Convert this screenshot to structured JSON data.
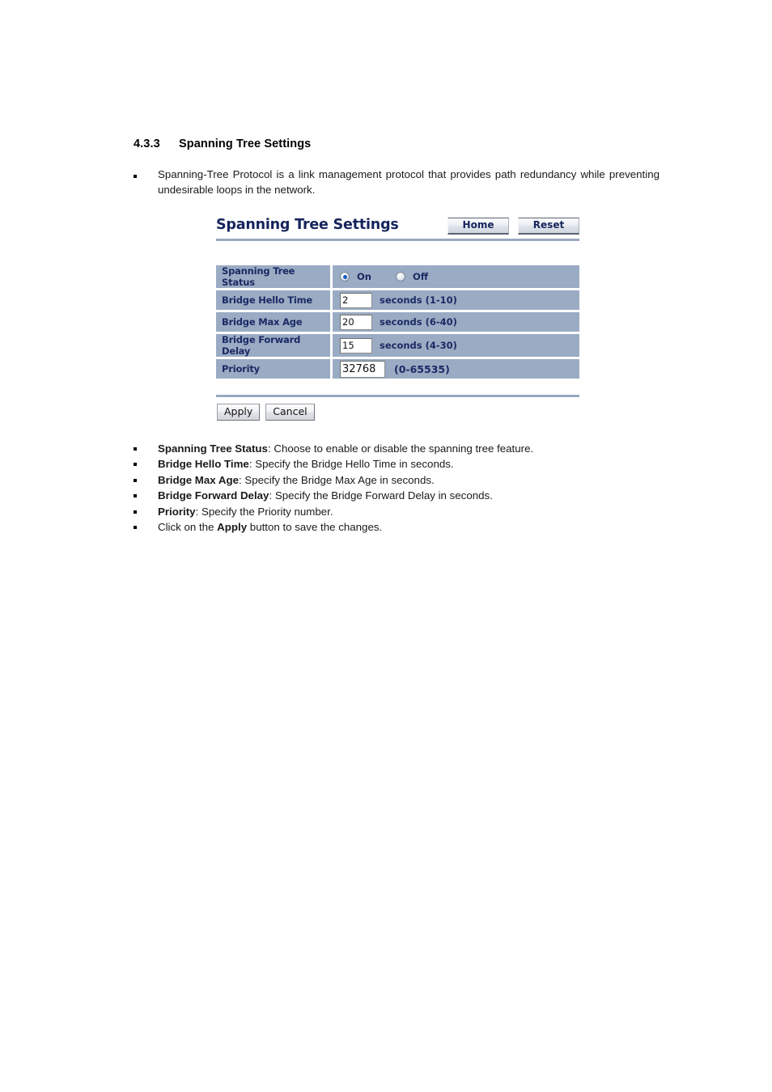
{
  "document": {
    "heading_number": "4.3.3",
    "heading_title": "Spanning Tree Settings",
    "intro_bullet": "Spanning-Tree Protocol is a link management protocol that provides path redundancy while preventing undesirable loops in the network."
  },
  "ui": {
    "title": "Spanning Tree Settings",
    "header_buttons": {
      "home": "Home",
      "reset": "Reset"
    },
    "rows": [
      {
        "label": "Spanning Tree Status",
        "type": "radio",
        "options": [
          {
            "label": "On",
            "checked": true
          },
          {
            "label": "Off",
            "checked": false
          }
        ]
      },
      {
        "label": "Bridge Hello Time",
        "type": "text",
        "value": "2",
        "unit": "seconds (1-10)"
      },
      {
        "label": "Bridge Max Age",
        "type": "text",
        "value": "20",
        "unit": "seconds (6-40)"
      },
      {
        "label": "Bridge Forward Delay",
        "type": "text",
        "value": "15",
        "unit": "seconds (4-30)"
      },
      {
        "label": "Priority",
        "type": "text",
        "value": "32768",
        "unit": "(0-65535)"
      }
    ],
    "footer_buttons": {
      "apply": "Apply",
      "cancel": "Cancel"
    },
    "colors": {
      "row_background": "#9aabc4",
      "label_text": "#1b2a63",
      "title_text": "#16245c",
      "rule": "#9aa8c0",
      "radio_dot": "#1358c8"
    }
  },
  "descriptions": [
    {
      "term": "Spanning Tree Status",
      "rest": ": Choose to enable or disable the spanning tree feature."
    },
    {
      "term": "Bridge Hello Time",
      "rest": ": Specify the Bridge Hello Time in seconds."
    },
    {
      "term": "Bridge Max Age",
      "rest": ": Specify the Bridge Max Age in seconds."
    },
    {
      "term": "Bridge Forward Delay",
      "rest": ": Specify the Bridge Forward Delay in seconds."
    },
    {
      "term": "Priority",
      "rest": ": Specify the Priority number."
    },
    {
      "pre": "Click on the ",
      "term": "Apply",
      "rest": " button to save the changes."
    }
  ]
}
